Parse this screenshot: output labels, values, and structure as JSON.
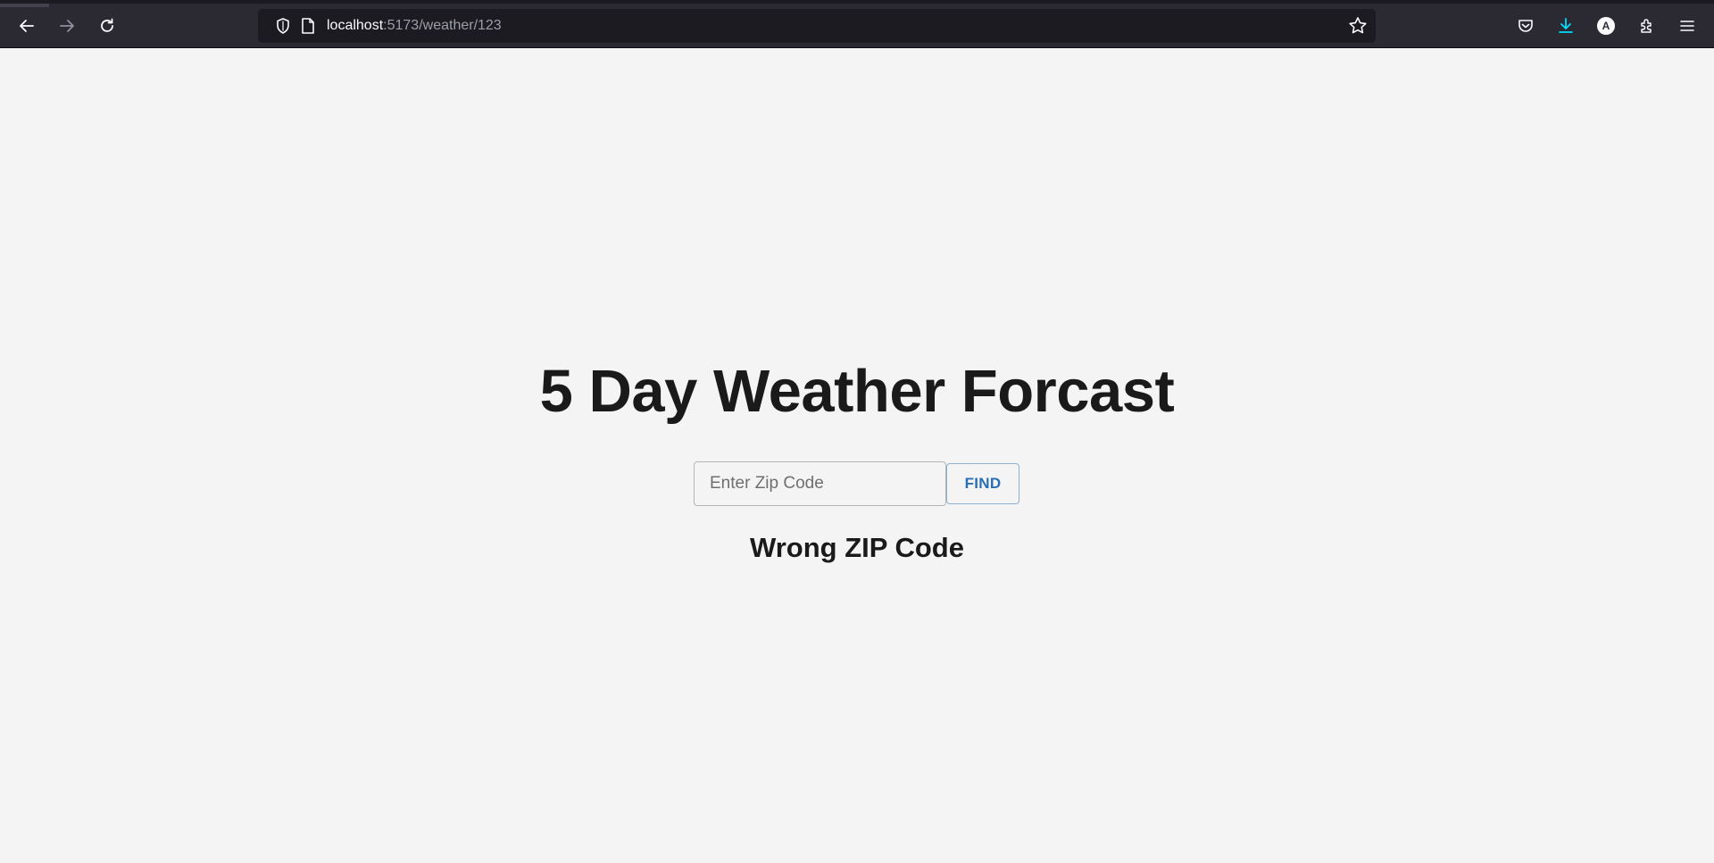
{
  "browser": {
    "url_host": "localhost",
    "url_path": ":5173/weather/123",
    "icons": {
      "back": "back-arrow-icon",
      "forward": "forward-arrow-icon",
      "reload": "reload-icon",
      "tracking": "shield-icon",
      "page": "page-icon",
      "bookmark": "star-icon",
      "pocket": "pocket-icon",
      "downloads": "download-icon",
      "account": "account-icon",
      "extensions": "puzzle-icon",
      "menu": "hamburger-menu-icon"
    },
    "account_initial": "A",
    "colors": {
      "toolbar": "#2b2a33",
      "urlbar": "#1c1b22",
      "download_accent": "#00ddff"
    }
  },
  "page": {
    "title": "5 Day Weather Forcast",
    "zip_input": {
      "value": "",
      "placeholder": "Enter Zip Code"
    },
    "find_label": "FIND",
    "message": "Wrong ZIP Code",
    "colors": {
      "background": "#f4f4f4",
      "text": "#1a1a1a",
      "button_text": "#2a6fb3"
    }
  }
}
